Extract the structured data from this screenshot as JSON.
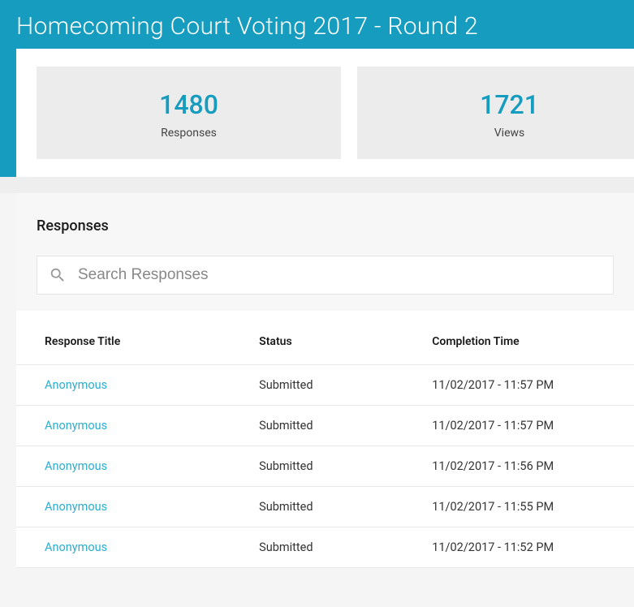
{
  "header": {
    "title": "Homecoming Court Voting 2017 - Round 2"
  },
  "stats": [
    {
      "value": "1480",
      "label": "Responses"
    },
    {
      "value": "1721",
      "label": "Views"
    }
  ],
  "responses_section": {
    "title": "Responses",
    "search_placeholder": "Search Responses"
  },
  "table": {
    "headers": {
      "title": "Response Title",
      "status": "Status",
      "completion": "Completion Time"
    },
    "rows": [
      {
        "title": "Anonymous",
        "status": "Submitted",
        "completion": "11/02/2017 - 11:57 PM"
      },
      {
        "title": "Anonymous",
        "status": "Submitted",
        "completion": "11/02/2017 - 11:57 PM"
      },
      {
        "title": "Anonymous",
        "status": "Submitted",
        "completion": "11/02/2017 - 11:56 PM"
      },
      {
        "title": "Anonymous",
        "status": "Submitted",
        "completion": "11/02/2017 - 11:55 PM"
      },
      {
        "title": "Anonymous",
        "status": "Submitted",
        "completion": "11/02/2017 - 11:52 PM"
      }
    ]
  }
}
